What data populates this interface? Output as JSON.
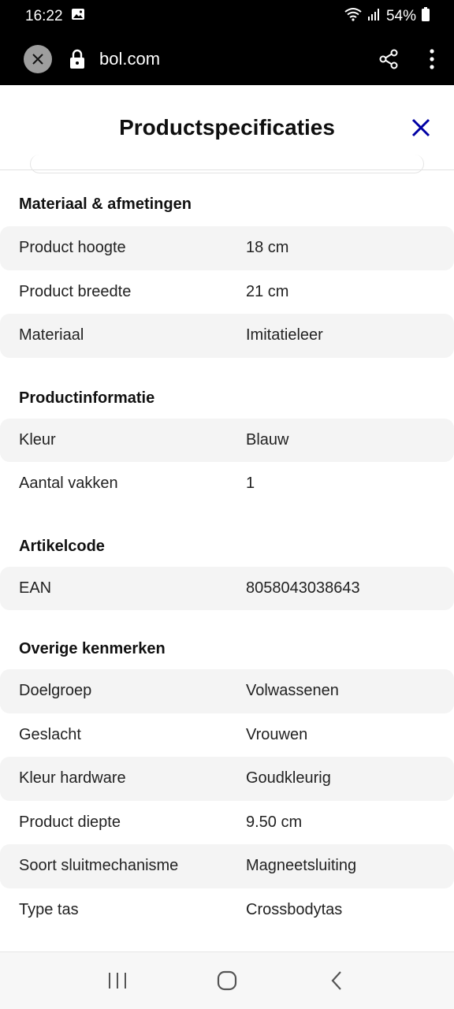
{
  "status_bar": {
    "time": "16:22",
    "battery": "54%",
    "icons": [
      "image-icon",
      "wifi-icon",
      "signal-icon",
      "battery-icon"
    ]
  },
  "browser": {
    "url": "bol.com",
    "icons": [
      "close-icon",
      "lock-icon",
      "share-icon",
      "more-vert-icon"
    ]
  },
  "sheet": {
    "title": "Productspecificaties",
    "close_icon": "close-icon",
    "accent_color": "#0000a4"
  },
  "sections": [
    {
      "title": "Materiaal & afmetingen",
      "rows": [
        {
          "label": "Product hoogte",
          "value": "18 cm"
        },
        {
          "label": "Product breedte",
          "value": "21 cm"
        },
        {
          "label": "Materiaal",
          "value": "Imitatieleer"
        }
      ]
    },
    {
      "title": "Productinformatie",
      "rows": [
        {
          "label": "Kleur",
          "value": "Blauw"
        },
        {
          "label": "Aantal vakken",
          "value": "1"
        }
      ]
    },
    {
      "title": "Artikelcode",
      "rows": [
        {
          "label": "EAN",
          "value": "8058043038643"
        }
      ]
    },
    {
      "title": "Overige kenmerken",
      "rows": [
        {
          "label": "Doelgroep",
          "value": "Volwassenen"
        },
        {
          "label": "Geslacht",
          "value": "Vrouwen"
        },
        {
          "label": "Kleur hardware",
          "value": "Goudkleurig"
        },
        {
          "label": "Product diepte",
          "value": "9.50 cm"
        },
        {
          "label": "Soort sluitmechanisme",
          "value": "Magneetsluiting"
        },
        {
          "label": "Type tas",
          "value": "Crossbodytas"
        }
      ]
    }
  ],
  "nav_bar": {
    "icons": [
      "recents-icon",
      "home-icon",
      "back-icon"
    ]
  }
}
